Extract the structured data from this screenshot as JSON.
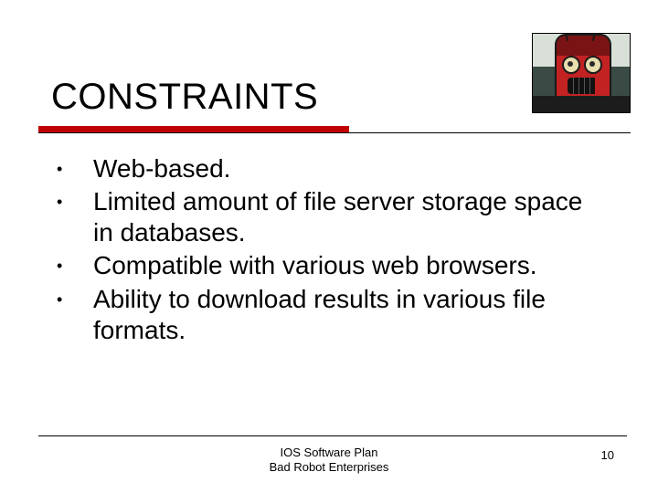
{
  "title": "CONSTRAINTS",
  "bullets": [
    "Web-based.",
    "Limited amount of file server storage space in databases.",
    "Compatible with various web browsers.",
    "Ability to download results in various file formats."
  ],
  "footer": {
    "line1": "IOS Software Plan",
    "line2": "Bad Robot Enterprises"
  },
  "page_number": "10",
  "image_alt": "bad-robot-logo"
}
